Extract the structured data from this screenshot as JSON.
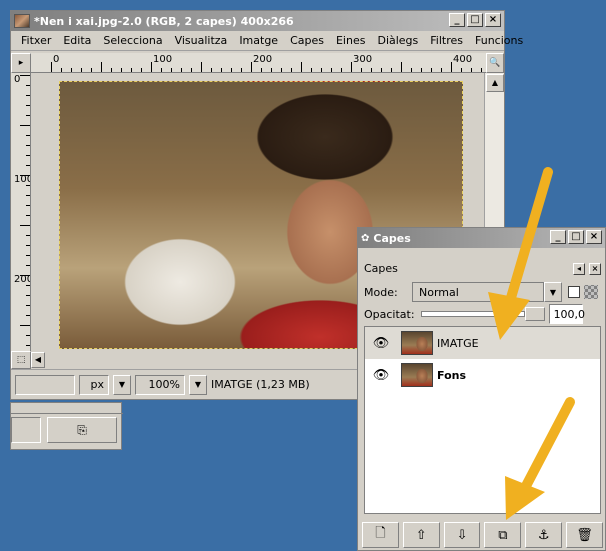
{
  "image_window": {
    "title": "*Nen i xai.jpg-2.0 (RGB, 2 capes) 400x266",
    "window_buttons": [
      "_",
      "□",
      "×"
    ],
    "menu": [
      "Fitxer",
      "Edita",
      "Selecciona",
      "Visualitza",
      "Imatge",
      "Capes",
      "Eines",
      "Diàlegs",
      "Filtres",
      "Funcions"
    ],
    "ruler_h_labels": [
      "0",
      "100",
      "200",
      "300",
      "400"
    ],
    "ruler_v_labels": [
      "0",
      "100",
      "200"
    ],
    "status": {
      "coords": "",
      "unit": "px",
      "zoom": "100%",
      "info": "IMATGE (1,23 MB)"
    }
  },
  "layers_dialog": {
    "title": "Capes",
    "window_buttons": [
      "_",
      "□",
      "×"
    ],
    "section_label": "Capes",
    "mode_label": "Mode:",
    "mode_value": "Normal",
    "opacity_label": "Opacitat:",
    "opacity_value": "100,0",
    "layers": [
      {
        "name": "IMATGE",
        "visible": true,
        "selected": true
      },
      {
        "name": "Fons",
        "visible": true,
        "selected": false
      }
    ],
    "buttons": [
      "new-layer",
      "raise-layer",
      "lower-layer",
      "duplicate-layer",
      "anchor-layer",
      "delete-layer"
    ]
  },
  "icons": {
    "eye": "eye-icon",
    "arrow_color": "#f0b020"
  }
}
